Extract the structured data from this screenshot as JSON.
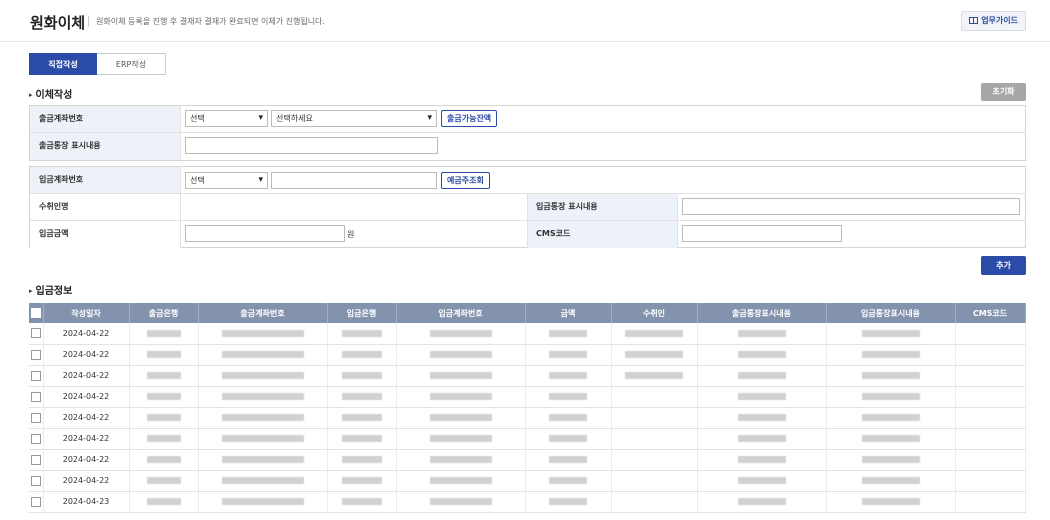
{
  "header": {
    "title": "원화이체",
    "description": "원화이체 등록을 진행 후 결재자 결재가 완료되면 이체가 진행됩니다.",
    "guide_button": "업무가이드",
    "guide_icon": "book-icon"
  },
  "tabs": [
    {
      "label": "직접작성",
      "active": true
    },
    {
      "label": "ERP작성",
      "active": false
    }
  ],
  "transfer_section": {
    "title": "이체작성",
    "reset_button": "초기화",
    "withdraw_account_label": "출금계좌번호",
    "withdraw_select1": "선택",
    "withdraw_select2": "선택하세요",
    "balance_button": "출금가능잔액",
    "withdraw_memo_label": "출금통장 표시내용",
    "withdraw_memo_value": "",
    "deposit_account_label": "입금계좌번호",
    "deposit_select": "선택",
    "deposit_account_value": "",
    "holder_lookup_button": "예금주조회",
    "recipient_label": "수취인명",
    "deposit_memo_label": "입금통장 표시내용",
    "deposit_memo_value": "",
    "amount_label": "입금금액",
    "amount_value": "",
    "amount_unit": "원",
    "cms_label": "CMS코드",
    "cms_value": "",
    "add_button": "추가"
  },
  "deposit_section": {
    "title": "입금정보",
    "columns": [
      "작성일자",
      "출금은행",
      "출금계좌번호",
      "입금은행",
      "입금계좌번호",
      "금액",
      "수취인",
      "출금통장표시내용",
      "입금통장표시내용",
      "CMS코드"
    ],
    "rows": [
      {
        "date": "2024-04-22",
        "has_recipient": true
      },
      {
        "date": "2024-04-22",
        "has_recipient": true
      },
      {
        "date": "2024-04-22",
        "has_recipient": true
      },
      {
        "date": "2024-04-22",
        "has_recipient": false
      },
      {
        "date": "2024-04-22",
        "has_recipient": false
      },
      {
        "date": "2024-04-22",
        "has_recipient": false
      },
      {
        "date": "2024-04-22",
        "has_recipient": false
      },
      {
        "date": "2024-04-22",
        "has_recipient": false
      },
      {
        "date": "2024-04-23",
        "has_recipient": false
      }
    ]
  },
  "colors": {
    "primary": "#2b4ba8",
    "table_header": "#8493ad",
    "label_bg": "#edf1f8",
    "reset_gray": "#a7a7a7"
  }
}
